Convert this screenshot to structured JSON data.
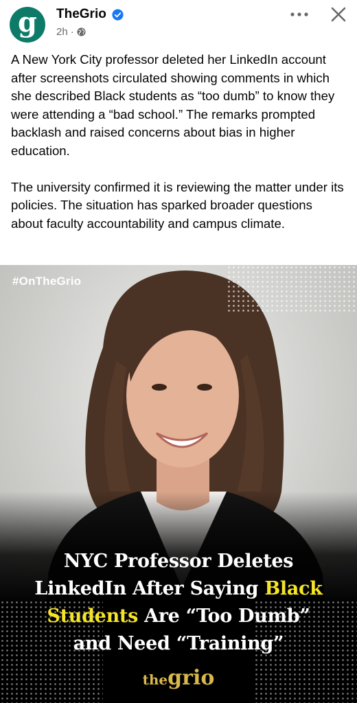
{
  "header": {
    "avatar_letter": "g",
    "page_name": "TheGrio",
    "time": "2h",
    "separator": "·"
  },
  "caption": {
    "paragraph1": "A New York City professor deleted her LinkedIn account after screenshots circulated showing comments in which she described Black students as “too dumb” to know they were attending a “bad school.” The remarks prompted backlash and raised concerns about bias in higher education.",
    "paragraph2": "The university confirmed it is reviewing the matter under its policies. The situation has sparked broader questions about faculty accountability and campus climate."
  },
  "image": {
    "hashtag": "#OnTheGrio",
    "headline": {
      "line1": "NYC Professor Deletes",
      "line2_a": "LinkedIn After Saying ",
      "line2_b": "Black",
      "line3_a": "Students",
      "line3_b": " Are “Too Dumb”",
      "line4": "and Need “Training”"
    },
    "brand_the": "the",
    "brand_grio": "grio"
  },
  "colors": {
    "avatar": "#0e7b68",
    "verified": "#1877f2",
    "highlight": "#f5e428",
    "brand": "#d9b84c"
  },
  "icons": [
    "verified-badge-icon",
    "globe-icon",
    "more-options-icon",
    "close-icon"
  ]
}
